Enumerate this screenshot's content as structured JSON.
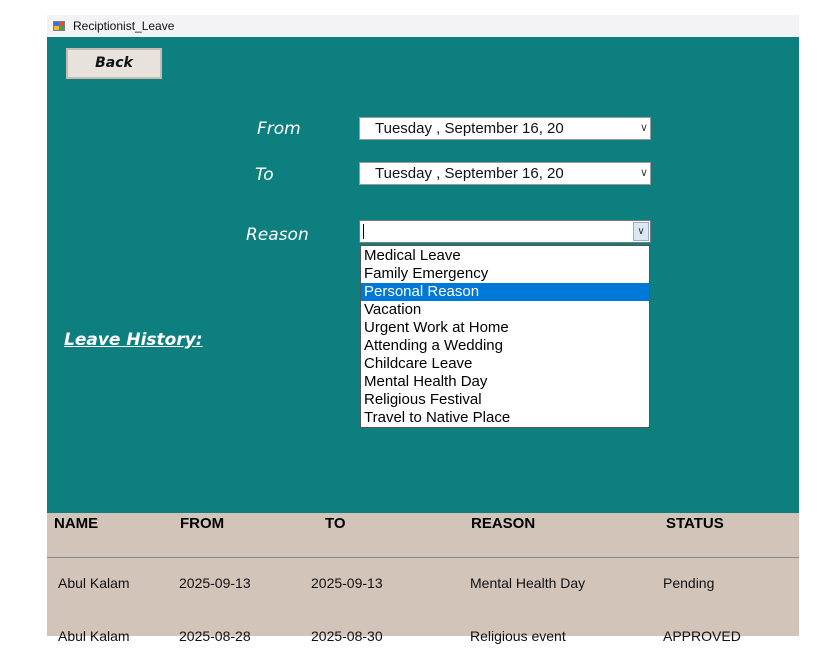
{
  "window": {
    "title": "Reciptionist_Leave"
  },
  "back_button": {
    "label": "Back"
  },
  "form": {
    "from_label": "From",
    "from_value": "Tuesday , September 16, 20",
    "to_label": "To",
    "to_value": "Tuesday , September 16, 20",
    "reason_label": "Reason",
    "reason_value": "",
    "reason_options": [
      "Medical Leave",
      "Family Emergency",
      "Personal Reason",
      "Vacation",
      "Urgent Work at Home",
      "Attending a Wedding",
      "Childcare Leave",
      "Mental Health Day",
      "Religious Festival",
      "Travel to Native Place"
    ],
    "highlighted_option": "Personal Reason"
  },
  "history_label": "Leave History:",
  "table": {
    "columns": [
      "NAME",
      "FROM",
      "TO",
      "REASON",
      "STATUS"
    ],
    "rows": [
      [
        "Abul Kalam",
        "2025-09-13",
        "2025-09-13",
        "Mental Health Day",
        "Pending"
      ],
      [
        "Abul Kalam",
        "2025-08-28",
        "2025-08-30",
        "Religious event",
        "APPROVED"
      ]
    ]
  },
  "colors": {
    "background": "#0d7f7f",
    "table_bg": "#d3c4ba",
    "highlight": "#0078d7"
  }
}
